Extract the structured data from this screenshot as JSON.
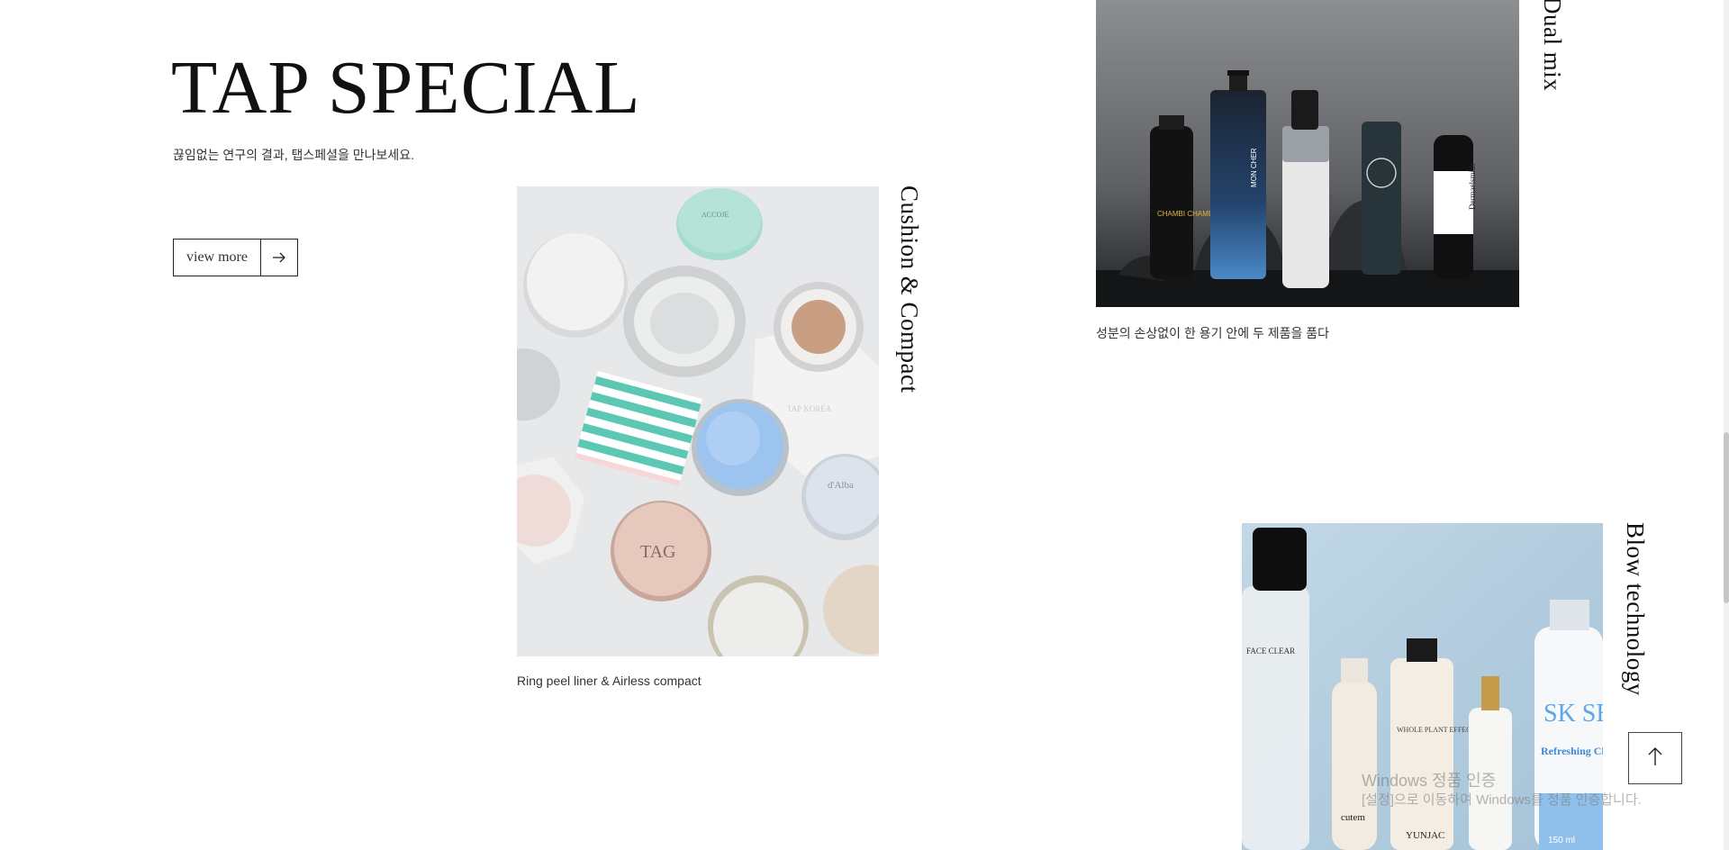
{
  "header": {
    "title": "TAP SPECIAL",
    "subtitle": "끊임없는 연구의 결과, 탭스페셜을 만나보세요."
  },
  "view_more": {
    "label": "view more",
    "icon": "arrow-right-icon"
  },
  "products": [
    {
      "title": "Cushion & Compact",
      "caption": "Ring peel liner & Airless compact",
      "image": "cushion-compact-product-photo"
    },
    {
      "title": "Dual mix",
      "caption": "성분의 손상없이 한 용기 안에 두 제품을 품다",
      "image": "dual-mix-bottles-photo"
    },
    {
      "title": "Blow technology",
      "caption": "",
      "image": "blow-technology-bottles-photo"
    }
  ],
  "product_labels": {
    "cushion": [
      "ACCOJE",
      "TAG",
      "d'Alba",
      "TAP KOREA"
    ],
    "dual": [
      "CHAMBI CHAMBI",
      "MON CHER",
      "Dermaelsmith"
    ],
    "blow": [
      "FACE CLEAR",
      "WHOLE PLANT EFFECT",
      "cutem",
      "YUNJAC",
      "SK SECRET",
      "Refreshing Cleansing Gel",
      "150 ml"
    ]
  },
  "scroll_top": {
    "icon": "arrow-up-icon"
  },
  "watermark": {
    "line1": "Windows 정품 인증",
    "line2": "[설정]으로 이동하여 Windows를 정품 인증합니다."
  },
  "colors": {
    "text": "#111111",
    "border": "#222222",
    "dual_bg": "#6f7175",
    "blow_bg": "#b9d2e3",
    "cushion_bg": "#e6e7e8"
  }
}
